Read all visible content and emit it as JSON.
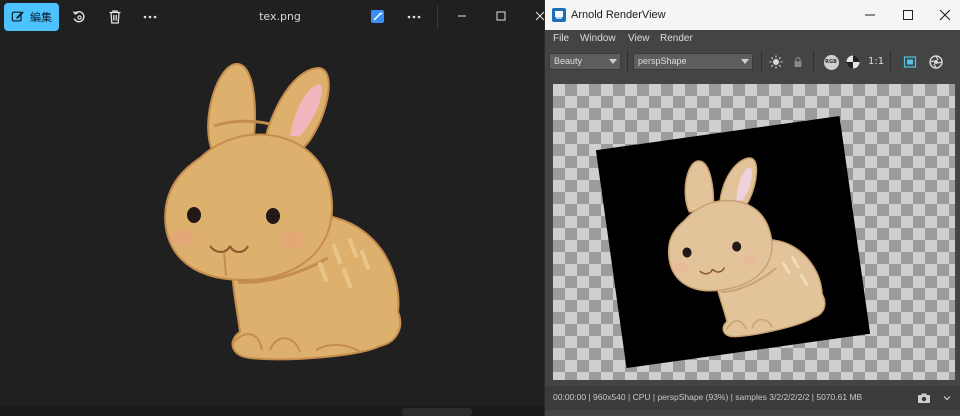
{
  "photos": {
    "edit_label": "編集",
    "file_title": "tex.png"
  },
  "arnold": {
    "window_title": "Arnold RenderView",
    "menu": [
      "File",
      "Window",
      "View",
      "Render"
    ],
    "aov_dropdown": "Beauty",
    "camera_dropdown": "perspShape",
    "rgb_label": "RGB",
    "zoom_label": "1:1",
    "status": "00:00:00 | 960x540 | CPU | perspShape (93%) | samples 3/2/2/2/2/2 | 5070.61 MB"
  },
  "colors": {
    "accent": "#4cc2ff",
    "photos_bg": "#202020",
    "arnold_panel": "#444444",
    "rabbit_fur": "#ddb06d",
    "rabbit_outline": "#c58d4d",
    "ear_inner": "#f2b6bf"
  },
  "icons": {
    "edit": "edit-icon",
    "rotate": "rotate-icon",
    "delete": "trash-icon",
    "more": "more-icon",
    "enhance": "enhance-icon",
    "minimize": "minimize-icon",
    "maximize": "maximize-icon",
    "close": "close-icon"
  }
}
